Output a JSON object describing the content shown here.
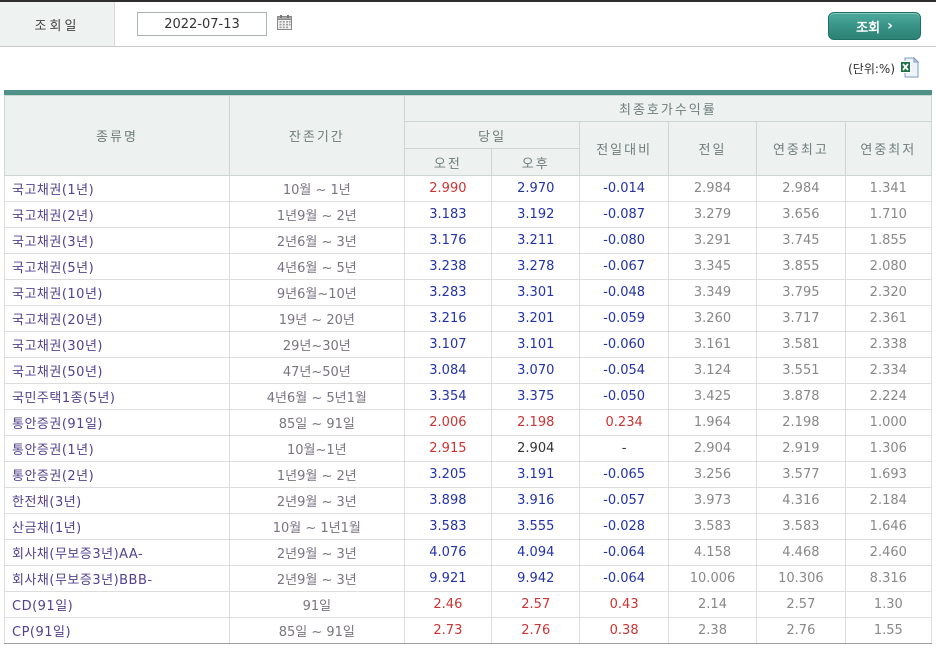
{
  "toolbar": {
    "date_label": "조회일",
    "date_value": "2022-07-13",
    "search_label": "조회",
    "search_arrow": "›"
  },
  "unit_label": "(단위:%)",
  "icons": {
    "calendar": "calendar-icon",
    "excel": "excel-file-icon"
  },
  "colors": {
    "up": "#cc3333",
    "down": "#2233aa",
    "flat": "#333333",
    "muted": "#888888",
    "accent_teal": "#4e9287",
    "name_purple": "#54418e"
  },
  "table": {
    "headers": {
      "type": "종류명",
      "period": "잔존기간",
      "yield_group": "최종호가수익률",
      "today_group": "당일",
      "am": "오전",
      "pm": "오후",
      "change": "전일대비",
      "prev": "전일",
      "year_high": "연중최고",
      "year_low": "연중최저"
    },
    "rows": [
      {
        "name": "국고채권(1년)",
        "period": "10월 ~ 1년",
        "am": "2.990",
        "am_dir": "up",
        "pm": "2.970",
        "pm_dir": "down",
        "change": "-0.014",
        "change_dir": "down",
        "prev": "2.984",
        "high": "2.984",
        "low": "1.341",
        "group_start": true
      },
      {
        "name": "국고채권(2년)",
        "period": "1년9월 ~ 2년",
        "am": "3.183",
        "am_dir": "down",
        "pm": "3.192",
        "pm_dir": "down",
        "change": "-0.087",
        "change_dir": "down",
        "prev": "3.279",
        "high": "3.656",
        "low": "1.710",
        "group_start": false
      },
      {
        "name": "국고채권(3년)",
        "period": "2년6월 ~ 3년",
        "am": "3.176",
        "am_dir": "down",
        "pm": "3.211",
        "pm_dir": "down",
        "change": "-0.080",
        "change_dir": "down",
        "prev": "3.291",
        "high": "3.745",
        "low": "1.855",
        "group_start": false
      },
      {
        "name": "국고채권(5년)",
        "period": "4년6월 ~ 5년",
        "am": "3.238",
        "am_dir": "down",
        "pm": "3.278",
        "pm_dir": "down",
        "change": "-0.067",
        "change_dir": "down",
        "prev": "3.345",
        "high": "3.855",
        "low": "2.080",
        "group_start": false
      },
      {
        "name": "국고채권(10년)",
        "period": "9년6월~10년",
        "am": "3.283",
        "am_dir": "down",
        "pm": "3.301",
        "pm_dir": "down",
        "change": "-0.048",
        "change_dir": "down",
        "prev": "3.349",
        "high": "3.795",
        "low": "2.320",
        "group_start": false
      },
      {
        "name": "국고채권(20년)",
        "period": "19년 ~ 20년",
        "am": "3.216",
        "am_dir": "down",
        "pm": "3.201",
        "pm_dir": "down",
        "change": "-0.059",
        "change_dir": "down",
        "prev": "3.260",
        "high": "3.717",
        "low": "2.361",
        "group_start": false
      },
      {
        "name": "국고채권(30년)",
        "period": "29년~30년",
        "am": "3.107",
        "am_dir": "down",
        "pm": "3.101",
        "pm_dir": "down",
        "change": "-0.060",
        "change_dir": "down",
        "prev": "3.161",
        "high": "3.581",
        "low": "2.338",
        "group_start": false
      },
      {
        "name": "국고채권(50년)",
        "period": "47년~50년",
        "am": "3.084",
        "am_dir": "down",
        "pm": "3.070",
        "pm_dir": "down",
        "change": "-0.054",
        "change_dir": "down",
        "prev": "3.124",
        "high": "3.551",
        "low": "2.334",
        "group_start": false
      },
      {
        "name": "국민주택1종(5년)",
        "period": "4년6월 ~ 5년1월",
        "am": "3.354",
        "am_dir": "down",
        "pm": "3.375",
        "pm_dir": "down",
        "change": "-0.050",
        "change_dir": "down",
        "prev": "3.425",
        "high": "3.878",
        "low": "2.224",
        "group_start": true
      },
      {
        "name": "통안증권(91일)",
        "period": "85일 ~ 91일",
        "am": "2.006",
        "am_dir": "up",
        "pm": "2.198",
        "pm_dir": "up",
        "change": "0.234",
        "change_dir": "up",
        "prev": "1.964",
        "high": "2.198",
        "low": "1.000",
        "group_start": true
      },
      {
        "name": "통안증권(1년)",
        "period": "10월~1년",
        "am": "2.915",
        "am_dir": "up",
        "pm": "2.904",
        "pm_dir": "flat",
        "change": "-",
        "change_dir": "flat",
        "prev": "2.904",
        "high": "2.919",
        "low": "1.306",
        "group_start": false
      },
      {
        "name": "통안증권(2년)",
        "period": "1년9월 ~ 2년",
        "am": "3.205",
        "am_dir": "down",
        "pm": "3.191",
        "pm_dir": "down",
        "change": "-0.065",
        "change_dir": "down",
        "prev": "3.256",
        "high": "3.577",
        "low": "1.693",
        "group_start": false
      },
      {
        "name": "한전채(3년)",
        "period": "2년9월 ~ 3년",
        "am": "3.898",
        "am_dir": "down",
        "pm": "3.916",
        "pm_dir": "down",
        "change": "-0.057",
        "change_dir": "down",
        "prev": "3.973",
        "high": "4.316",
        "low": "2.184",
        "group_start": true
      },
      {
        "name": "산금채(1년)",
        "period": "10월 ~ 1년1월",
        "am": "3.583",
        "am_dir": "down",
        "pm": "3.555",
        "pm_dir": "down",
        "change": "-0.028",
        "change_dir": "down",
        "prev": "3.583",
        "high": "3.583",
        "low": "1.646",
        "group_start": true
      },
      {
        "name": "회사채(무보증3년)AA-",
        "period": "2년9월 ~ 3년",
        "am": "4.076",
        "am_dir": "down",
        "pm": "4.094",
        "pm_dir": "down",
        "change": "-0.064",
        "change_dir": "down",
        "prev": "4.158",
        "high": "4.468",
        "low": "2.460",
        "group_start": true
      },
      {
        "name": "회사채(무보증3년)BBB-",
        "period": "2년9월 ~ 3년",
        "am": "9.921",
        "am_dir": "down",
        "pm": "9.942",
        "pm_dir": "down",
        "change": "-0.064",
        "change_dir": "down",
        "prev": "10.006",
        "high": "10.306",
        "low": "8.316",
        "group_start": false
      },
      {
        "name": "CD(91일)",
        "period": "91일",
        "am": "2.46",
        "am_dir": "up",
        "pm": "2.57",
        "pm_dir": "up",
        "change": "0.43",
        "change_dir": "up",
        "prev": "2.14",
        "high": "2.57",
        "low": "1.30",
        "group_start": true
      },
      {
        "name": "CP(91일)",
        "period": "85일 ~ 91일",
        "am": "2.73",
        "am_dir": "up",
        "pm": "2.76",
        "pm_dir": "up",
        "change": "0.38",
        "change_dir": "up",
        "prev": "2.38",
        "high": "2.76",
        "low": "1.55",
        "group_start": false
      }
    ]
  }
}
